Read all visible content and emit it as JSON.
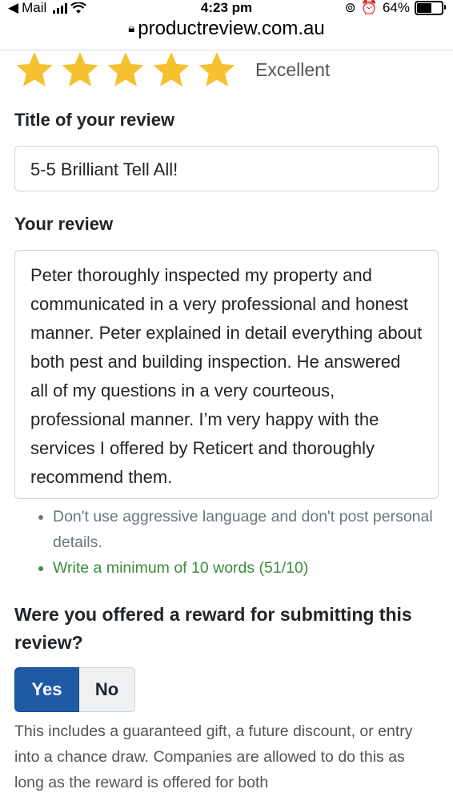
{
  "status_bar": {
    "back_app": "Mail",
    "time": "4:23 pm",
    "battery": "64%",
    "battery_level": 0.64
  },
  "browser": {
    "url": "productreview.com.au"
  },
  "rating": {
    "stars": 5,
    "max_stars": 5,
    "label": "Excellent",
    "star_color": "#f5c12e"
  },
  "form": {
    "title_label": "Title of your review",
    "title_value": "5-5 Brilliant Tell All!",
    "review_label": "Your review",
    "review_text": "Peter thoroughly inspected my property and communicated in a very professional and honest manner. Peter explained in detail everything about both pest and building inspection. He answered all of my questions in a very courteous, professional manner. I’m very happy with the services I offered by Reticert and thoroughly recommend them.",
    "hints": [
      "Don't use aggressive language and don't post personal details.",
      "Write a minimum of 10 words (51/10)"
    ],
    "reward_question": "Were you offered a reward for submitting this review?",
    "yes_label": "Yes",
    "no_label": "No",
    "selected": "Yes",
    "reward_help": "This includes a guaranteed gift, a future discount, or entry into a chance draw. Companies are allowed to do this as long as the reward is offered for both"
  },
  "colors": {
    "accent": "#1f5aa6",
    "success": "#3b8c3b",
    "star": "#f5c12e"
  }
}
